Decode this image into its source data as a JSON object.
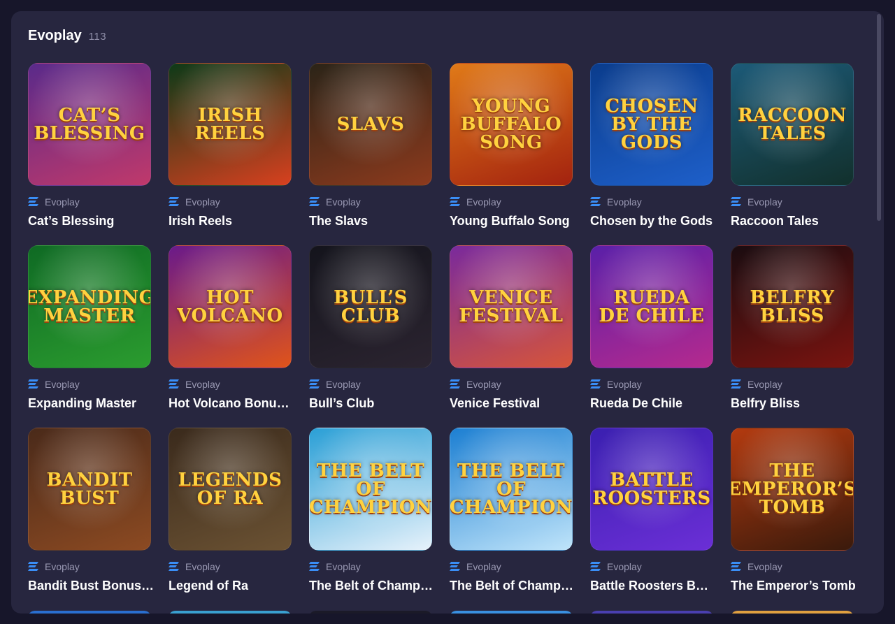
{
  "section": {
    "title": "Evoplay",
    "count": "113"
  },
  "games": [
    {
      "name": "Cat’s Blessing",
      "provider": "Evoplay",
      "logo": "Cat’s Blessing",
      "bg1": "#5a2a8a",
      "bg2": "#c0396b"
    },
    {
      "name": "Irish Reels",
      "provider": "Evoplay",
      "logo": "Irish Reels",
      "bg1": "#0d3a18",
      "bg2": "#d8401f"
    },
    {
      "name": "The Slavs",
      "provider": "Evoplay",
      "logo": "Slavs",
      "bg1": "#2b2418",
      "bg2": "#8c3a1d"
    },
    {
      "name": "Young Buffalo Song",
      "provider": "Evoplay",
      "logo": "Young Buffalo Song",
      "bg1": "#e07a18",
      "bg2": "#a3220f"
    },
    {
      "name": "Chosen by the Gods",
      "provider": "Evoplay",
      "logo": "Chosen by the Gods",
      "bg1": "#0a3c8c",
      "bg2": "#1e5fc9"
    },
    {
      "name": "Raccoon Tales",
      "provider": "Evoplay",
      "logo": "Raccoon Tales",
      "bg1": "#1c5a78",
      "bg2": "#12302c"
    },
    {
      "name": "Expanding Master",
      "provider": "Evoplay",
      "logo": "Expanding Master",
      "bg1": "#0f6a24",
      "bg2": "#2b9c2f"
    },
    {
      "name": "Hot Volcano Bonus Buy",
      "provider": "Evoplay",
      "logo": "Hot Volcano",
      "bg1": "#6a1a8a",
      "bg2": "#e0541a"
    },
    {
      "name": "Bull’s Club",
      "provider": "Evoplay",
      "logo": "Bull’s Club",
      "bg1": "#14141c",
      "bg2": "#2b2430"
    },
    {
      "name": "Venice Festival",
      "provider": "Evoplay",
      "logo": "Venice Festival",
      "bg1": "#7a2a9c",
      "bg2": "#d6553a"
    },
    {
      "name": "Rueda De Chile",
      "provider": "Evoplay",
      "logo": "Rueda de Chile",
      "bg1": "#5a1fa8",
      "bg2": "#b52a8e"
    },
    {
      "name": "Belfry Bliss",
      "provider": "Evoplay",
      "logo": "Belfry Bliss",
      "bg1": "#1a0c10",
      "bg2": "#7a1410"
    },
    {
      "name": "Bandit Bust Bonus Buy",
      "provider": "Evoplay",
      "logo": "Bandit Bust",
      "bg1": "#4a2a1a",
      "bg2": "#8c4a22"
    },
    {
      "name": "Legend of Ra",
      "provider": "Evoplay",
      "logo": "Legends of Ra",
      "bg1": "#3a2a1c",
      "bg2": "#6b5233"
    },
    {
      "name": "The Belt of Champion Bonus Buy",
      "provider": "Evoplay",
      "logo": "The Belt of Champion",
      "bg1": "#2a9fd6",
      "bg2": "#e7f2fb"
    },
    {
      "name": "The Belt of Champion",
      "provider": "Evoplay",
      "logo": "The Belt of Champion",
      "bg1": "#1c7fd2",
      "bg2": "#bfe4fa"
    },
    {
      "name": "Battle Roosters Bonus Buy",
      "provider": "Evoplay",
      "logo": "Battle Roosters",
      "bg1": "#3a1fb0",
      "bg2": "#6b2fd6"
    },
    {
      "name": "The Emperor’s Tomb",
      "provider": "Evoplay",
      "logo": "The Emperor’s Tomb",
      "bg1": "#b33a0f",
      "bg2": "#3a1a0c"
    }
  ],
  "colors": {
    "page_bg": "#17162a",
    "panel_bg": "#27263f",
    "provider_mark": "#3a8ef6"
  },
  "icons": {
    "provider": "evoplay-logo-icon"
  }
}
